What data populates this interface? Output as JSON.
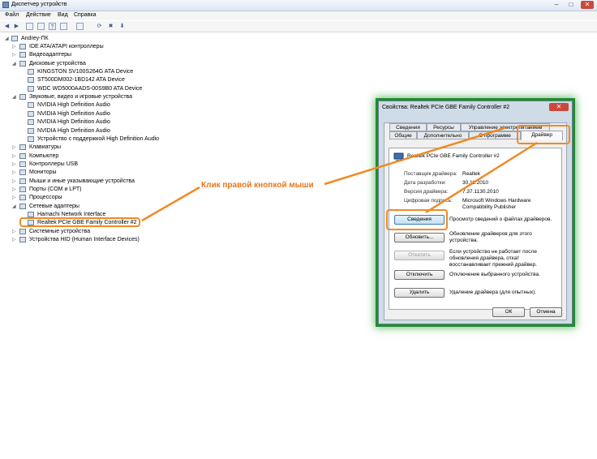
{
  "window": {
    "title": "Диспетчер устройств"
  },
  "menu": [
    "Файл",
    "Действие",
    "Вид",
    "Справка"
  ],
  "tree": {
    "root": "Andrey-ПК",
    "items": [
      {
        "label": "IDE ATA/ATAPI контроллеры",
        "level": 1,
        "expanded": false
      },
      {
        "label": "Видеоадаптеры",
        "level": 1,
        "expanded": false
      },
      {
        "label": "Дисковые устройства",
        "level": 1,
        "expanded": true
      },
      {
        "label": "KINGSTON SV100S264G ATA Device",
        "level": 2
      },
      {
        "label": "ST500DM002-1BD142 ATA Device",
        "level": 2
      },
      {
        "label": "WDC WD5000AADS-00S9B0 ATA Device",
        "level": 2
      },
      {
        "label": "Звуковые, видео и игровые устройства",
        "level": 1,
        "expanded": true
      },
      {
        "label": "NVIDIA High Definition Audio",
        "level": 2
      },
      {
        "label": "NVIDIA High Definition Audio",
        "level": 2
      },
      {
        "label": "NVIDIA High Definition Audio",
        "level": 2
      },
      {
        "label": "NVIDIA High Definition Audio",
        "level": 2
      },
      {
        "label": "Устройство с поддержкой High Definition Audio",
        "level": 2
      },
      {
        "label": "Клавиатуры",
        "level": 1,
        "expanded": false
      },
      {
        "label": "Компьютер",
        "level": 1,
        "expanded": false
      },
      {
        "label": "Контроллеры USB",
        "level": 1,
        "expanded": false
      },
      {
        "label": "Мониторы",
        "level": 1,
        "expanded": false
      },
      {
        "label": "Мыши и иные указывающие устройства",
        "level": 1,
        "expanded": false
      },
      {
        "label": "Порты (COM и LPT)",
        "level": 1,
        "expanded": false
      },
      {
        "label": "Процессоры",
        "level": 1,
        "expanded": false
      },
      {
        "label": "Сетевые адаптеры",
        "level": 1,
        "expanded": true
      },
      {
        "label": "Hamachi Network Interface",
        "level": 2
      },
      {
        "label": "Realtek PCIe GBE Family Controller #2",
        "level": 2,
        "highlighted": true
      },
      {
        "label": "Системные устройства",
        "level": 1,
        "expanded": false
      },
      {
        "label": "Устройства HID (Human Interface Devices)",
        "level": 1,
        "expanded": false
      }
    ]
  },
  "callout": "Клик правой кнопкой мыши",
  "dialog": {
    "title": "Свойства: Realtek PCIe GBE Family Controller #2",
    "close": "✕",
    "tabs_row1": [
      "Сведения",
      "Ресурсы",
      "Управление электропитанием"
    ],
    "tabs_row2": [
      "Общие",
      "Дополнительно",
      "О программе",
      "Драйвер"
    ],
    "active_tab": "Драйвер",
    "device_name": "Realtek PCIe GBE Family Controller #2",
    "fields": [
      {
        "label": "Поставщик драйвера:",
        "value": "Realtek"
      },
      {
        "label": "Дата разработки:",
        "value": "30.11.2010"
      },
      {
        "label": "Версия драйвера:",
        "value": "7.37.1130.2010"
      },
      {
        "label": "Цифровая подпись:",
        "value": "Microsoft Windows Hardware Compatibility Publisher"
      }
    ],
    "actions": [
      {
        "button": "Сведения",
        "desc": "Просмотр сведений о файлах драйверов."
      },
      {
        "button": "Обновить...",
        "desc": "Обновление драйверов для этого устройства."
      },
      {
        "button": "Откатить",
        "desc": "Если устройство не работает после обновления драйвера, откат восстанавливает прежний драйвер.",
        "disabled": true
      },
      {
        "button": "Отключить",
        "desc": "Отключение выбранного устройства."
      },
      {
        "button": "Удалить",
        "desc": "Удаление драйвера (для опытных)."
      }
    ],
    "ok": "ОК",
    "cancel": "Отмена"
  },
  "colors": {
    "annotation": "#f08a24",
    "glow": "#1f8c2d"
  }
}
